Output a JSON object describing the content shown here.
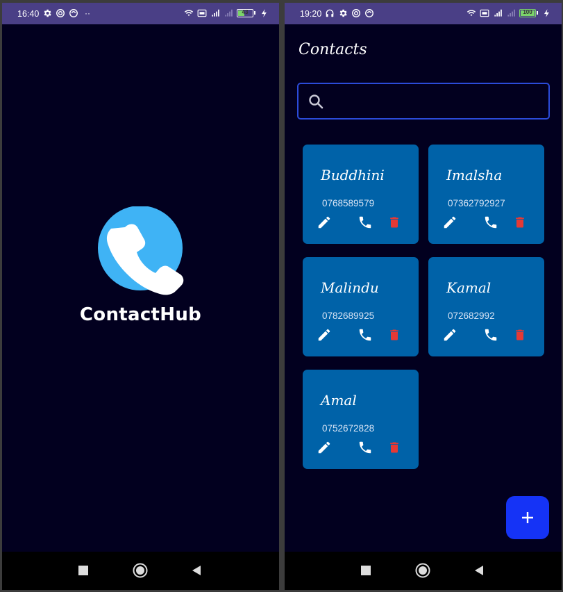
{
  "splash": {
    "status_time": "16:40",
    "battery": "43",
    "app_name": "ContactHub"
  },
  "contacts_screen": {
    "status_time": "19:20",
    "battery": "100",
    "title": "Contacts",
    "search": {
      "value": "",
      "placeholder": ""
    },
    "contacts": [
      {
        "name": "Buddhini",
        "phone": "0768589579"
      },
      {
        "name": "Imalsha",
        "phone": "07362792927"
      },
      {
        "name": "Malindu",
        "phone": "0782689925"
      },
      {
        "name": "Kamal",
        "phone": "072682992"
      },
      {
        "name": "Amal",
        "phone": "0752672828"
      }
    ]
  },
  "colors": {
    "background": "#02001f",
    "status_bar": "#4a3f86",
    "card": "#0062a8",
    "delete": "#e53935",
    "fab": "#1533f6",
    "logo": "#3fb3f5"
  },
  "icons": [
    "search-icon",
    "edit-icon",
    "phone-icon",
    "trash-icon",
    "add-icon",
    "wifi-icon",
    "signal-icon",
    "battery-icon",
    "gear-icon",
    "headset-icon"
  ]
}
